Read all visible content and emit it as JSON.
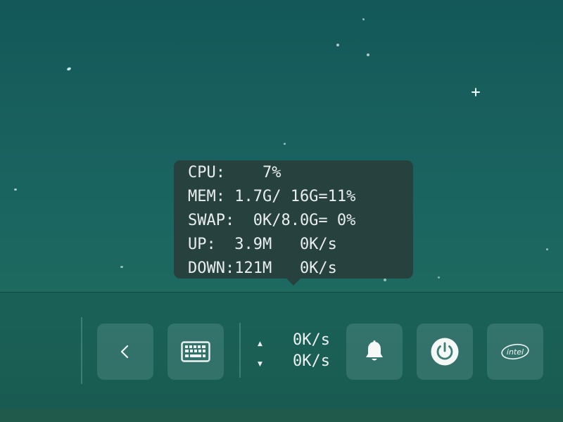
{
  "tooltip": {
    "lines": [
      "CPU:    7%",
      "MEM: 1.7G/ 16G=11%",
      "SWAP:  0K/8.0G= 0%",
      "UP:  3.9M   0K/s",
      "DOWN:121M   0K/s"
    ]
  },
  "panel": {
    "network": {
      "upload": "0K/s",
      "download": "0K/s"
    },
    "icons": {
      "back": "chevron-left-icon",
      "keyboard": "keyboard-icon",
      "notifications": "bell-icon",
      "power": "power-icon",
      "intel": "intel-logo-icon"
    },
    "intel_text": "intel"
  },
  "colors": {
    "text": "#e8efee",
    "tooltip_bg": "#283e3c",
    "tile_bg": "#78aaa5"
  }
}
